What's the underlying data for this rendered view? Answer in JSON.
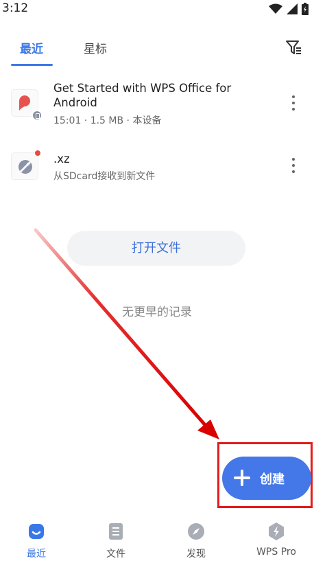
{
  "status": {
    "time": "3:12",
    "icons": [
      "wifi-icon",
      "signal-icon",
      "battery-icon"
    ]
  },
  "tabs": [
    {
      "label": "最近",
      "active": true
    },
    {
      "label": "星标",
      "active": false
    }
  ],
  "files": [
    {
      "title": "Get Started with WPS Office for Android",
      "meta": "15:01 · 1.5 MB · 本设备",
      "icon": "pdf-icon",
      "badge": "device-icon"
    },
    {
      "title": ".xz",
      "meta": "从SDcard接收到新文件",
      "icon": "unknown-file-icon",
      "badge": "red-dot"
    }
  ],
  "open_file_label": "打开文件",
  "no_more_label": "无更早的记录",
  "create_label": "创建",
  "nav": [
    {
      "label": "最近",
      "icon": "recent-icon",
      "active": true
    },
    {
      "label": "文件",
      "icon": "file-icon",
      "active": false
    },
    {
      "label": "发现",
      "icon": "compass-icon",
      "active": false
    },
    {
      "label": "WPS Pro",
      "icon": "lightning-icon",
      "active": false
    }
  ],
  "colors": {
    "accent": "#3b78e7",
    "annotation": "#e31b1b",
    "create_button": "#4477e8"
  }
}
